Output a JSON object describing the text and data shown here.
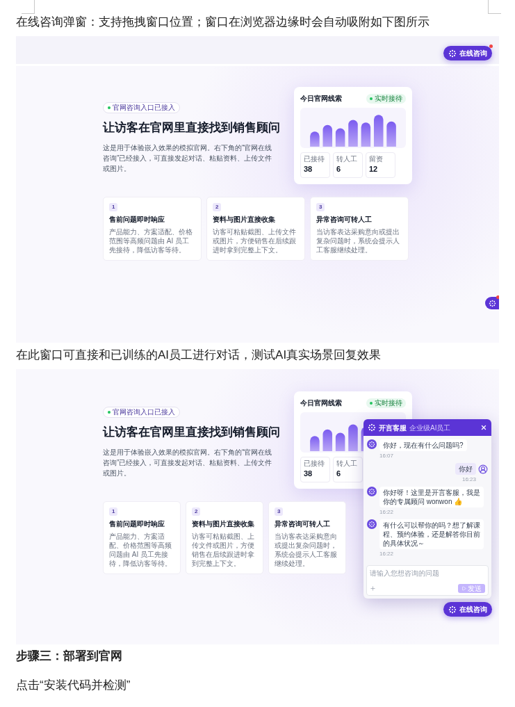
{
  "document": {
    "blocks": [
      {
        "kind": "text",
        "text": "在线咨询弹窗：支持拖拽窗口位置；窗口在浏览器边缘时会自动吸附如下图所示"
      },
      {
        "kind": "screenshot",
        "site": {
          "badge": "官网咨询入口已接入",
          "title": "让访客在官网里直接找到销售顾问",
          "description": "这是用于体验嵌入效果的模拟官网。右下角的“官网在线咨询”已经接入，可直接发起对话、粘贴资料、上传文件或图片。",
          "leads_card": {
            "title": "今日官网线索",
            "status": "实时接待",
            "stats": [
              {
                "label": "已接待",
                "value": "38"
              },
              {
                "label": "转人工",
                "value": "6"
              },
              {
                "label": "留资",
                "value": "12"
              }
            ]
          },
          "features": [
            {
              "number": "1",
              "title": "售前问题即时响应",
              "description": "产品能力、方案适配、价格范围等高频问题由 AI 员工先接待，降低访客等待。"
            },
            {
              "number": "2",
              "title": "资料与图片直接收集",
              "description": "访客可粘贴截图、上传文件或图片，方便销售在后续跟进时拿到完整上下文。"
            },
            {
              "number": "3",
              "title": "异常咨询可转人工",
              "description": "当访客表达采购意向或提出复杂问题时，系统会提示人工客服继续处理。"
            }
          ],
          "launchers": [
            {
              "kind": "top",
              "label": "在线咨询",
              "unread": true
            },
            {
              "kind": "edge",
              "unread": true
            }
          ]
        }
      },
      {
        "kind": "text",
        "text": "在此窗口可直接和已训练的AI员工进行对话，测试AI真实场景回复效果"
      },
      {
        "kind": "screenshot",
        "site": {
          "badge": "官网咨询入口已接入",
          "title": "让访客在官网里直接找到销售顾问",
          "description": "这是用于体验嵌入效果的模拟官网。右下角的“官网在线咨询”已经接入，可直接发起对话、粘贴资料、上传文件或图片。",
          "leads_card": {
            "title": "今日官网线索",
            "status": "实时接待",
            "stats": [
              {
                "label": "已接待",
                "value": "38"
              },
              {
                "label": "转人工",
                "value": "6"
              }
            ]
          },
          "features": [
            {
              "number": "1",
              "title": "售前问题即时响应",
              "description": "产品能力、方案适配、价格范围等高频问题由 AI 员工先接待，降低访客等待。"
            },
            {
              "number": "2",
              "title": "资料与图片直接收集",
              "description": "访客可粘贴截图、上传文件或图片，方便销售在后续跟进时拿到完整上下文。"
            },
            {
              "number": "3",
              "title": "异常咨询可转人工",
              "description": "当访客表达采购意向或提出复杂问题时，系统会提示人工客服继续处理。"
            }
          ],
          "chat": {
            "title": "开言客服",
            "subtitle": "企业级AI员工",
            "messages": [
              {
                "kind": "bot",
                "text": "你好，现在有什么问题吗?",
                "time": "16:07"
              },
              {
                "kind": "user",
                "text": "你好",
                "time": "16:23"
              },
              {
                "kind": "bot",
                "text": "你好呀！这里是开言客服，我是你的专属顾问 wonwon 👍",
                "time": "16:22"
              },
              {
                "kind": "bot",
                "text": "有什么可以帮你的吗？想了解课程、预约体验，还是解答你目前的具体状况～",
                "time": "16:22"
              }
            ],
            "input": {
              "placeholder": "请输入您想咨询的问题"
            },
            "send": {
              "label": "发送",
              "disabled": true
            }
          },
          "launchers": [
            {
              "kind": "bottom",
              "label": "在线咨询",
              "unread": false
            }
          ]
        }
      },
      {
        "kind": "heading",
        "text": "步骤三：部署到官网"
      },
      {
        "kind": "text",
        "text": "点击“安装代码并检测”"
      }
    ]
  }
}
